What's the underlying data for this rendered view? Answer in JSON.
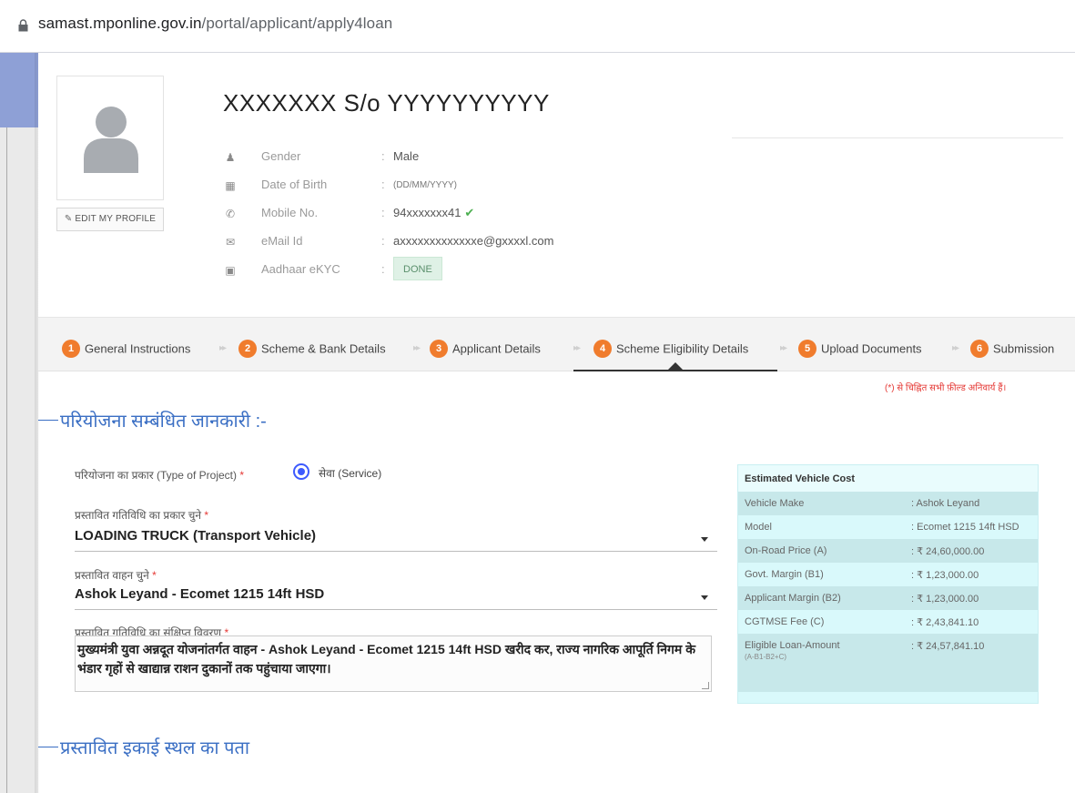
{
  "browser": {
    "url_domain": "samast.mponline.gov.in",
    "url_path": "/portal/applicant/apply4loan"
  },
  "profile": {
    "name": "XXXXXXX S/o YYYYYYYYYY",
    "edit_label": "EDIT MY PROFILE",
    "fields": [
      {
        "icon": "person-icon",
        "label": "Gender",
        "value": "Male"
      },
      {
        "icon": "calendar-icon",
        "label": "Date of Birth",
        "value": "(DD/MM/YYYY)"
      },
      {
        "icon": "phone-icon",
        "label": "Mobile No.",
        "value": "94xxxxxxx41"
      },
      {
        "icon": "mail-icon",
        "label": "eMail Id",
        "value": "axxxxxxxxxxxxxe@gxxxxl.com"
      },
      {
        "icon": "id-card-icon",
        "label": "Aadhaar eKYC",
        "value": "DONE"
      }
    ]
  },
  "steps": [
    {
      "num": "1",
      "label": "General Instructions"
    },
    {
      "num": "2",
      "label": "Scheme & Bank Details"
    },
    {
      "num": "3",
      "label": "Applicant Details"
    },
    {
      "num": "4",
      "label": "Scheme Eligibility Details"
    },
    {
      "num": "5",
      "label": "Upload Documents"
    },
    {
      "num": "6",
      "label": "Submission"
    }
  ],
  "active_step": "4",
  "required_note": "(*) से चिह्नित सभी फ़ील्ड अनिवार्य हैं।",
  "section1_title": "परियोजना सम्बंधित जानकारी :-",
  "section2_title": "प्रस्तावित इकाई स्थल का पता",
  "form": {
    "project_type_label": "परियोजना का प्रकार (Type of Project)",
    "project_type_option": "सेवा (Service)",
    "activity_label": "प्रस्तावित गतिविधि का प्रकार चुने",
    "activity_value": "LOADING TRUCK (Transport Vehicle)",
    "vehicle_label": "प्रस्तावित वाहन चुने",
    "vehicle_value": "Ashok Leyand - Ecomet 1215 14ft HSD",
    "description_label": "प्रस्तावित गतिविधि का संक्षिप्त विवरण",
    "description_value": "मुख्यमंत्री युवा अन्नदूत योजनांतर्गत वाहन - Ashok Leyand - Ecomet 1215 14ft HSD  खरीद कर, राज्य नागरिक आपूर्ति निगम के भंडार गृहों से खाद्यान्न राशन दुकानों तक पहुंचाया जाएगा।",
    "required_mark": "*"
  },
  "cost_card": {
    "title": "Estimated Vehicle Cost",
    "rows": [
      {
        "label": "Vehicle Make",
        "value": ": Ashok Leyand",
        "sub": ""
      },
      {
        "label": "Model",
        "value": ": Ecomet 1215 14ft HSD",
        "sub": ""
      },
      {
        "label": "On-Road Price (A)",
        "value": ": ₹ 24,60,000.00",
        "sub": ""
      },
      {
        "label": "Govt. Margin (B1)",
        "value": ": ₹ 1,23,000.00",
        "sub": ""
      },
      {
        "label": "Applicant Margin (B2)",
        "value": ": ₹ 1,23,000.00",
        "sub": ""
      },
      {
        "label": "CGTMSE Fee (C)",
        "value": ": ₹ 2,43,841.10",
        "sub": ""
      },
      {
        "label": "Eligible Loan-Amount",
        "value": ": ₹ 24,57,841.10",
        "sub": "(A-B1-B2+C)"
      }
    ]
  },
  "colors": {
    "step_badge": "#f07c2d",
    "section_title": "#3b6fc4",
    "required": "#e53935",
    "cost_card_bg": "#d9f9fb",
    "verified_tick": "#4caf50"
  }
}
